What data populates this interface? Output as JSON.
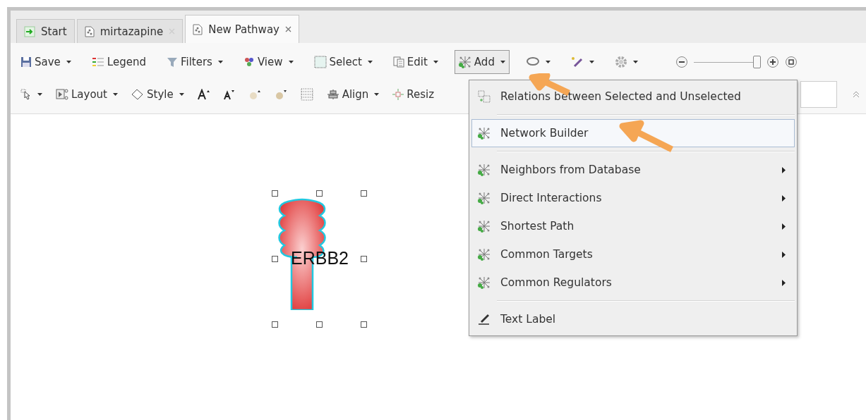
{
  "tabs": [
    {
      "label": "Start",
      "selected": false,
      "closable": false
    },
    {
      "label": "mirtazapine",
      "selected": false,
      "closable": true
    },
    {
      "label": "New Pathway",
      "selected": true,
      "closable": true
    }
  ],
  "toolbar_1": [
    {
      "label": "Save",
      "dropdown": true,
      "pressed": false
    },
    {
      "label": "Legend",
      "dropdown": false,
      "pressed": false
    },
    {
      "label": "Filters",
      "dropdown": true,
      "pressed": false
    },
    {
      "label": "View",
      "dropdown": true,
      "pressed": false
    },
    {
      "label": "Select",
      "dropdown": true,
      "pressed": false
    },
    {
      "label": "Edit",
      "dropdown": true,
      "pressed": false
    },
    {
      "label": "Add",
      "dropdown": true,
      "pressed": true
    },
    {
      "dropdown": true,
      "pressed": false
    },
    {
      "dropdown": true,
      "pressed": false
    },
    {
      "dropdown": true,
      "pressed": false
    }
  ],
  "zoom": {
    "level": 0.95
  },
  "toolbar_2": [
    {
      "dropdown": true
    },
    {
      "label": "Layout",
      "dropdown": true
    },
    {
      "label": "Style",
      "dropdown": true
    },
    {
      "dropdown": false
    },
    {
      "dropdown": false
    },
    {
      "dropdown": false
    },
    {
      "dropdown": false
    },
    {
      "dropdown": false
    },
    {
      "label": "Align",
      "dropdown": true
    },
    {
      "label": "Resiz",
      "dropdown": false
    }
  ],
  "add_menu": [
    {
      "kind": "item",
      "label": "Relations between Selected and Unselected",
      "submenu": false,
      "selected": false
    },
    {
      "kind": "separator"
    },
    {
      "kind": "item",
      "label": "Network Builder",
      "submenu": false,
      "selected": true
    },
    {
      "kind": "separator"
    },
    {
      "kind": "item",
      "label": "Neighbors from Database",
      "submenu": true,
      "selected": false
    },
    {
      "kind": "item",
      "label": "Direct Interactions",
      "submenu": true,
      "selected": false
    },
    {
      "kind": "item",
      "label": "Shortest Path",
      "submenu": true,
      "selected": false
    },
    {
      "kind": "item",
      "label": "Common Targets",
      "submenu": true,
      "selected": false
    },
    {
      "kind": "item",
      "label": "Common Regulators",
      "submenu": true,
      "selected": false
    },
    {
      "kind": "separator"
    },
    {
      "kind": "item",
      "label": "Text Label",
      "submenu": false,
      "selected": false
    }
  ],
  "canvas": {
    "nodes": [
      {
        "label": "ERBB2",
        "kind": "receptor",
        "selected": true
      }
    ]
  }
}
